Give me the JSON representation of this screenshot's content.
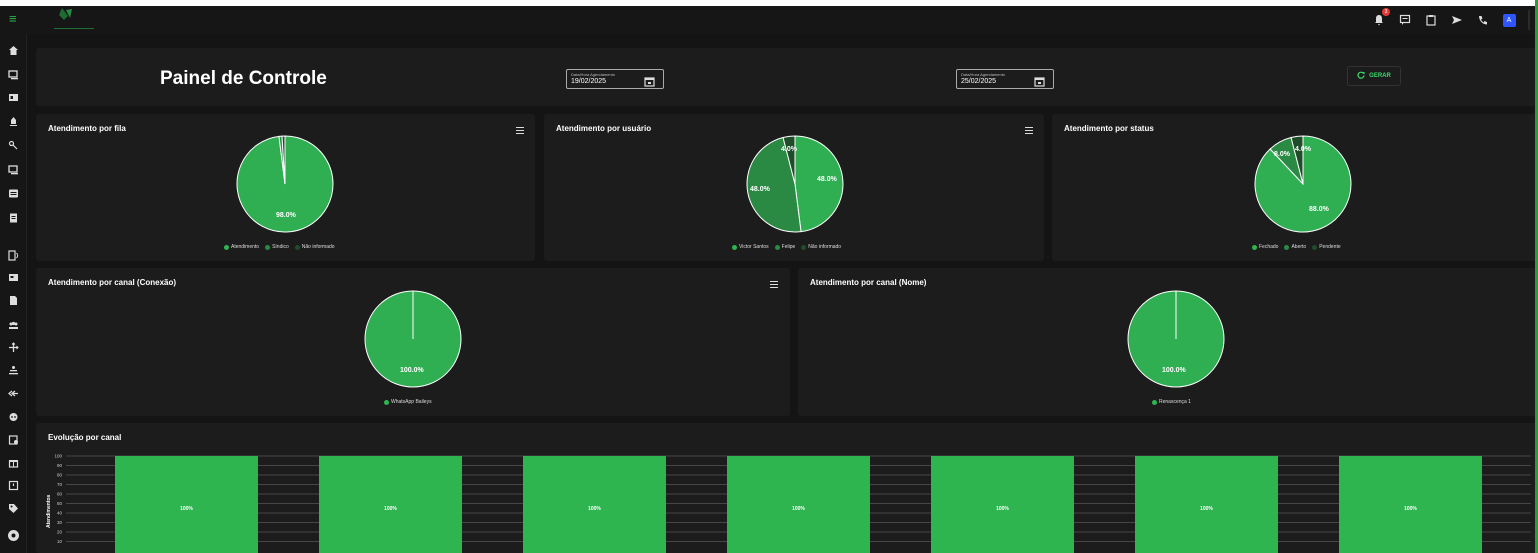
{
  "header": {
    "notification_count": "3",
    "avatar_letter": "A"
  },
  "dashboard": {
    "title": "Painel de Controle",
    "date_from": {
      "label": "Data/Hora Agendamento",
      "value": "19/02/2025"
    },
    "date_to": {
      "label": "Data/Hora Agendamento",
      "value": "25/02/2025"
    },
    "generate_label": "GERAR"
  },
  "colors": {
    "accent": "#2eb54f",
    "pie_dark": "#2a8a44",
    "pie_light": "#2fae52",
    "background": "#141414",
    "card": "#1c1c1c"
  },
  "cards": {
    "fila": {
      "title": "Atendimento por fila",
      "pct_label": "98.0%",
      "legend": [
        "Atendimento",
        "Síndico",
        "Não informado"
      ]
    },
    "usuario": {
      "title": "Atendimento por usuário",
      "pct_labels": [
        "48.0%",
        "48.0%",
        "4.0%"
      ],
      "legend": [
        "Victor Santos",
        "Felipe",
        "Não informado"
      ]
    },
    "status": {
      "title": "Atendimento por status",
      "pct_labels": [
        "88.0%",
        "8.0%",
        "4.0%"
      ],
      "legend": [
        "Fechado",
        "Aberto",
        "Pendente"
      ]
    },
    "canal_conexao": {
      "title": "Atendimento por canal (Conexão)",
      "pct_label": "100.0%",
      "legend": [
        "WhatsApp Baileys"
      ]
    },
    "canal_nome": {
      "title": "Atendimento por canal (Nome)",
      "pct_label": "100.0%",
      "legend": [
        "Renascença 1"
      ]
    },
    "evolucao": {
      "title": "Evolução por canal",
      "ylabel": "Atendimentos"
    }
  },
  "chart_data": [
    {
      "type": "pie",
      "title": "Atendimento por fila",
      "categories": [
        "Atendimento",
        "Síndico",
        "Não informado"
      ],
      "values": [
        98,
        1,
        1
      ]
    },
    {
      "type": "pie",
      "title": "Atendimento por usuário",
      "categories": [
        "Victor Santos",
        "Felipe",
        "Não informado"
      ],
      "values": [
        48,
        48,
        4
      ]
    },
    {
      "type": "pie",
      "title": "Atendimento por status",
      "categories": [
        "Fechado",
        "Aberto",
        "Pendente"
      ],
      "values": [
        88,
        8,
        4
      ]
    },
    {
      "type": "pie",
      "title": "Atendimento por canal (Conexão)",
      "categories": [
        "WhatsApp Baileys"
      ],
      "values": [
        100
      ]
    },
    {
      "type": "pie",
      "title": "Atendimento por canal (Nome)",
      "categories": [
        "Renascença 1"
      ],
      "values": [
        100
      ]
    },
    {
      "type": "bar",
      "title": "Evolução por canal",
      "ylabel": "Atendimentos",
      "ylim": [
        0,
        100
      ],
      "yticks": [
        10,
        20,
        30,
        40,
        50,
        60,
        70,
        80,
        90,
        100
      ],
      "values": [
        100,
        100,
        100,
        100,
        100,
        100,
        100
      ],
      "data_labels": [
        "100%",
        "100%",
        "100%",
        "100%",
        "100%",
        "100%",
        "100%"
      ]
    }
  ]
}
